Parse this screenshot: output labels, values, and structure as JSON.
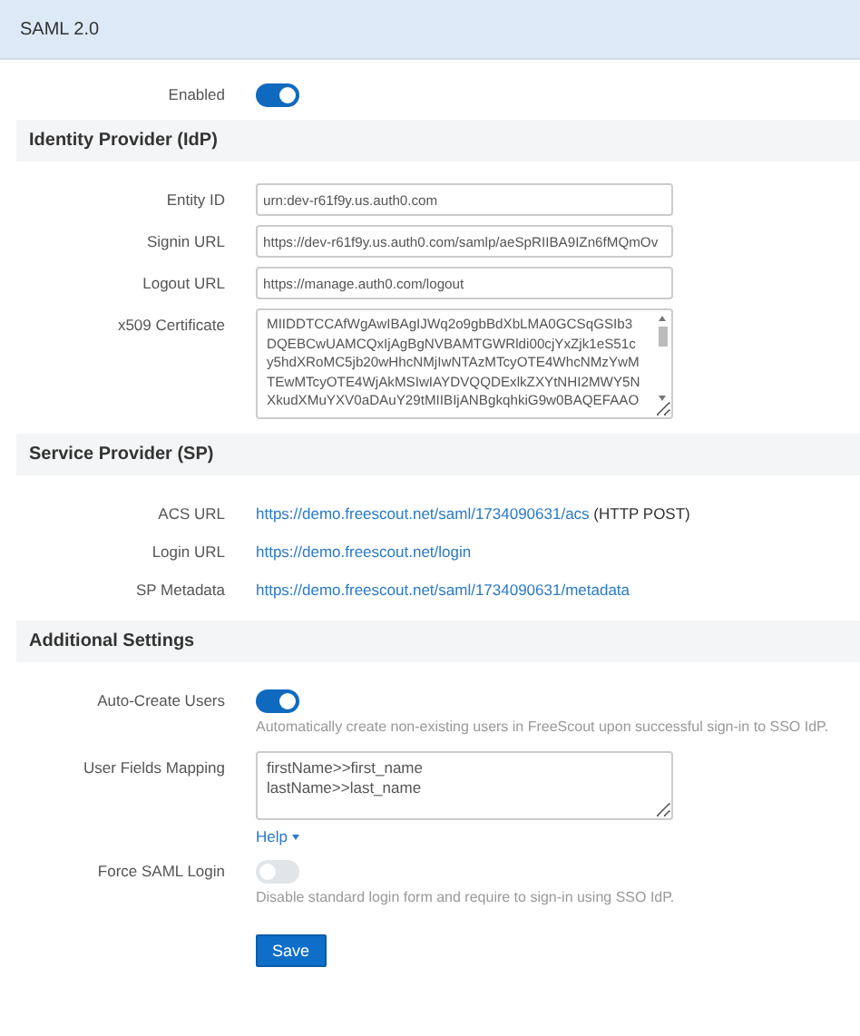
{
  "header": {
    "title": "SAML 2.0"
  },
  "top_rows": [
    {
      "kind": "toggle",
      "label": "Enabled",
      "on": true
    }
  ],
  "sections": [
    {
      "title": "Identity Provider (IdP)",
      "rows": [
        {
          "kind": "input",
          "label": "Entity ID",
          "value": "urn:dev-r61f9y.us.auth0.com"
        },
        {
          "kind": "input",
          "label": "Signin URL",
          "value": "https://dev-r61f9y.us.auth0.com/samlp/aeSpRIIBA9IZn6fMQmOv"
        },
        {
          "kind": "input",
          "label": "Logout URL",
          "value": "https://manage.auth0.com/logout"
        },
        {
          "kind": "scroll_textarea",
          "label": "x509 Certificate",
          "lines": [
            "MIIDDTCCAfWgAwIBAgIJWq2o9gbBdXbLMA0GCSqGSIb3",
            "DQEBCwUAMCQxIjAgBgNVBAMTGWRldi00cjYxZjk1eS51c",
            "y5hdXRoMC5jb20wHhcNMjIwNTAzMTcyOTE4WhcNMzYwM",
            "TEwMTcyOTE4WjAkMSIwIAYDVQQDExlkZXYtNHI2MWY5N",
            "XkudXMuYXV0aDAuY29tMIIBIjANBgkqhkiG9w0BAQEFAAO"
          ]
        }
      ]
    },
    {
      "title": "Service Provider (SP)",
      "rows": [
        {
          "kind": "link",
          "label": "ACS URL",
          "link": "https://demo.freescout.net/saml/1734090631/acs",
          "suffix": "(HTTP POST)"
        },
        {
          "kind": "link",
          "label": "Login URL",
          "link": "https://demo.freescout.net/login"
        },
        {
          "kind": "link",
          "label": "SP Metadata",
          "link": "https://demo.freescout.net/saml/1734090631/metadata"
        }
      ]
    },
    {
      "title": "Additional Settings",
      "rows": [
        {
          "kind": "toggle",
          "label": "Auto-Create Users",
          "on": true,
          "help": "Automatically create non-existing users in FreeScout upon successful sign-in to SSO IdP."
        },
        {
          "kind": "textarea",
          "label": "User Fields Mapping",
          "lines": [
            "firstName>>first_name",
            "lastName>>last_name"
          ],
          "dropdown": "Help"
        },
        {
          "kind": "toggle",
          "label": "Force SAML Login",
          "on": false,
          "help": "Disable standard login form and require to sign-in using SSO IdP."
        }
      ]
    }
  ],
  "save_button": "Save"
}
